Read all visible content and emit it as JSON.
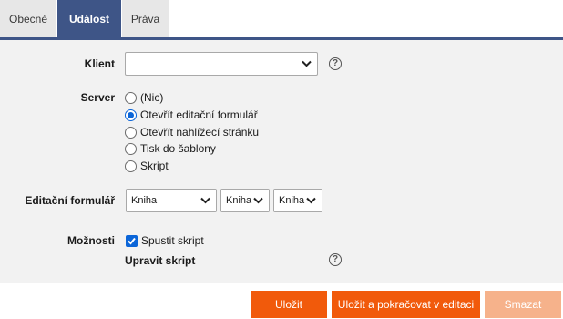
{
  "tabs": [
    {
      "label": "Obecné"
    },
    {
      "label": "Událost"
    },
    {
      "label": "Práva"
    }
  ],
  "client": {
    "label": "Klient",
    "value": "",
    "help_icon": "question-circle-icon"
  },
  "server": {
    "label": "Server",
    "options": [
      "(Nic)",
      "Otevřít editační formulář",
      "Otevřít nahlížecí stránku",
      "Tisk do šablony",
      "Skript"
    ],
    "selected": "Otevřít editační formulář"
  },
  "edit_form": {
    "label": "Editační formulář",
    "selects": [
      "Kniha",
      "Kniha",
      "Kniha"
    ]
  },
  "options": {
    "label": "Možnosti",
    "run_script": "Spustit skript",
    "run_script_checked": true,
    "edit_script": "Upravit skript"
  },
  "buttons": {
    "save": "Uložit",
    "save_continue": "Uložit a pokračovat v editaci",
    "delete": "Smazat"
  },
  "colors": {
    "accent": "#3e5587",
    "primary_button": "#f15a0b",
    "disabled_button": "#f6b28b",
    "radio_checked": "#0b65d8"
  }
}
